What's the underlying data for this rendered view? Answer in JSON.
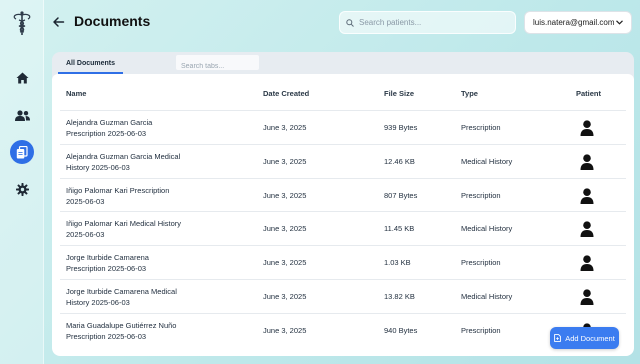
{
  "header": {
    "title": "Documents",
    "search_placeholder": "Search patients...",
    "account_email": "luis.natera@gmail.com"
  },
  "sidebar": {
    "items": [
      {
        "icon": "home-icon"
      },
      {
        "icon": "users-icon"
      },
      {
        "icon": "documents-icon",
        "active": true
      },
      {
        "icon": "gear-icon"
      }
    ]
  },
  "tabs": {
    "active_label": "All Documents",
    "search_placeholder": "Search tabs..."
  },
  "table": {
    "columns": [
      "Name",
      "Date Created",
      "File Size",
      "Type",
      "Patient"
    ],
    "rows": [
      {
        "name1": "Alejandra Guzman Garcia",
        "name2": "Prescription 2025-06-03",
        "date": "June 3, 2025",
        "size": "939 Bytes",
        "type": "Prescription"
      },
      {
        "name1": "Alejandra Guzman Garcia Medical",
        "name2": "History 2025-06-03",
        "date": "June 3, 2025",
        "size": "12.46 KB",
        "type": "Medical History"
      },
      {
        "name1": "Iñigo Palomar Kari Prescription",
        "name2": "2025-06-03",
        "date": "June 3, 2025",
        "size": "807 Bytes",
        "type": "Prescription"
      },
      {
        "name1": "Iñigo Palomar Kari Medical History",
        "name2": "2025-06-03",
        "date": "June 3, 2025",
        "size": "11.45 KB",
        "type": "Medical History"
      },
      {
        "name1": "Jorge Iturbide Camarena",
        "name2": "Prescription 2025-06-03",
        "date": "June 3, 2025",
        "size": "1.03 KB",
        "type": "Prescription"
      },
      {
        "name1": "Jorge Iturbide Camarena Medical",
        "name2": "History 2025-06-03",
        "date": "June 3, 2025",
        "size": "13.82 KB",
        "type": "Medical History"
      },
      {
        "name1": "Maria Guadalupe Gutiérrez Nuño",
        "name2": "Prescription 2025-06-03",
        "date": "June 3, 2025",
        "size": "940 Bytes",
        "type": "Prescription"
      }
    ]
  },
  "add_button_label": "Add Document",
  "colors": {
    "accent": "#2f6fe6",
    "button": "#3b7cf0"
  }
}
